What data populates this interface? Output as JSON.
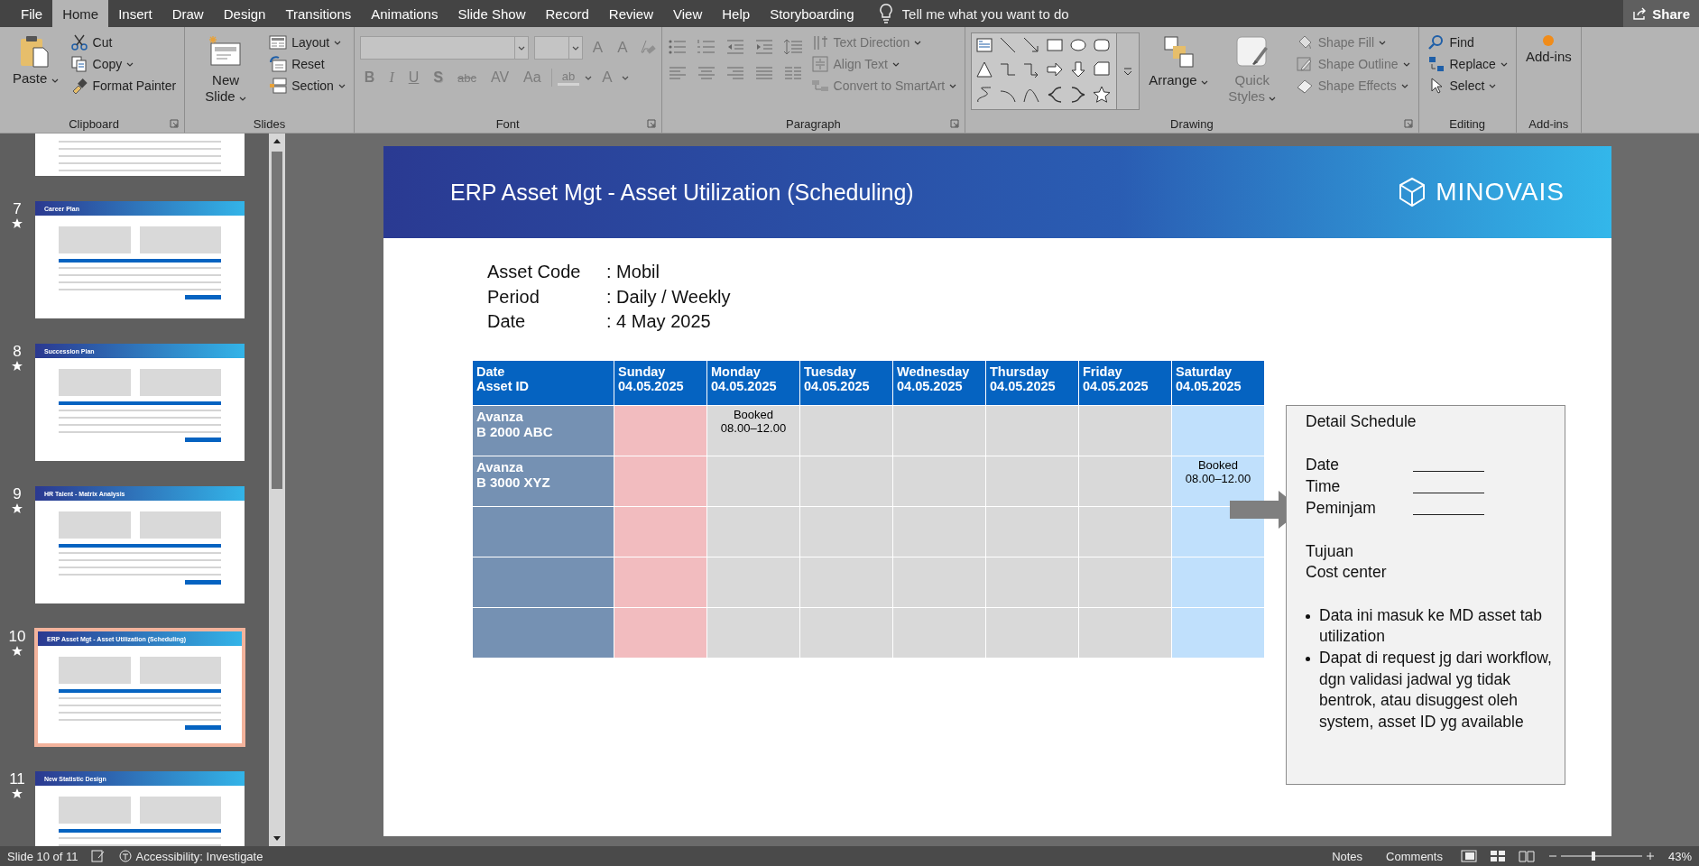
{
  "tabs": [
    {
      "label": "File",
      "selected": false
    },
    {
      "label": "Home",
      "selected": true
    },
    {
      "label": "Insert",
      "selected": false
    },
    {
      "label": "Draw",
      "selected": false
    },
    {
      "label": "Design",
      "selected": false
    },
    {
      "label": "Transitions",
      "selected": false
    },
    {
      "label": "Animations",
      "selected": false
    },
    {
      "label": "Slide Show",
      "selected": false
    },
    {
      "label": "Record",
      "selected": false
    },
    {
      "label": "Review",
      "selected": false
    },
    {
      "label": "View",
      "selected": false
    },
    {
      "label": "Help",
      "selected": false
    },
    {
      "label": "Storyboarding",
      "selected": false
    }
  ],
  "tell_me": {
    "placeholder": "Tell me what you want to do"
  },
  "share_button": "Share",
  "ribbon": {
    "groups": [
      {
        "label": "Clipboard",
        "launcher": true,
        "items": [
          {
            "kind": "large",
            "label": "Paste",
            "dropdown": true,
            "disabled": false
          },
          {
            "kind": "stack",
            "items": [
              {
                "label": "Cut",
                "dropdown": false,
                "disabled": false
              },
              {
                "label": "Copy",
                "dropdown": true,
                "disabled": false
              },
              {
                "label": "Format Painter",
                "dropdown": false,
                "disabled": false
              }
            ]
          }
        ]
      },
      {
        "label": "Slides",
        "launcher": false,
        "items": [
          {
            "kind": "large",
            "label": "New Slide",
            "dropdown": true,
            "disabled": false
          },
          {
            "kind": "stack",
            "items": [
              {
                "label": "Layout",
                "dropdown": true,
                "disabled": false
              },
              {
                "label": "Reset",
                "dropdown": false,
                "disabled": false
              },
              {
                "label": "Section",
                "dropdown": true,
                "disabled": false
              }
            ]
          }
        ]
      },
      {
        "label": "Font",
        "launcher": true,
        "items": [
          {
            "kind": "font",
            "disabled": true,
            "size_buttons": [
              "A",
              "A"
            ],
            "format_buttons": [
              "B",
              "I",
              "U",
              "S",
              "abc",
              "AV",
              "Aa"
            ],
            "highlight": "ab",
            "font_color": "A"
          }
        ]
      },
      {
        "label": "Paragraph",
        "launcher": true,
        "items": [
          {
            "kind": "paragraph",
            "disabled": true
          },
          {
            "kind": "stack",
            "items": [
              {
                "label": "Text Direction",
                "dropdown": true,
                "disabled": true
              },
              {
                "label": "Align Text",
                "dropdown": true,
                "disabled": true
              },
              {
                "label": "Convert to SmartArt",
                "dropdown": true,
                "disabled": true
              }
            ]
          }
        ]
      },
      {
        "label": "Drawing",
        "launcher": true,
        "items": [
          {
            "kind": "shapes"
          },
          {
            "kind": "large",
            "label": "Arrange",
            "dropdown": true,
            "disabled": false
          },
          {
            "kind": "large",
            "label": "Quick Styles",
            "dropdown": true,
            "disabled": true
          },
          {
            "kind": "stack",
            "items": [
              {
                "label": "Shape Fill",
                "dropdown": true,
                "disabled": true
              },
              {
                "label": "Shape Outline",
                "dropdown": true,
                "disabled": true
              },
              {
                "label": "Shape Effects",
                "dropdown": true,
                "disabled": true
              }
            ]
          }
        ]
      },
      {
        "label": "Editing",
        "launcher": false,
        "items": [
          {
            "kind": "stack",
            "items": [
              {
                "label": "Find",
                "dropdown": false,
                "disabled": false
              },
              {
                "label": "Replace",
                "dropdown": true,
                "disabled": false
              },
              {
                "label": "Select",
                "dropdown": true,
                "disabled": false
              }
            ]
          }
        ]
      },
      {
        "label": "Add-ins",
        "launcher": false,
        "items": [
          {
            "kind": "large",
            "label": "Add-ins",
            "dropdown": false,
            "disabled": false
          }
        ]
      }
    ]
  },
  "thumbnails": [
    {
      "kind": "partial",
      "selected": false
    },
    {
      "kind": "slide",
      "number": "7",
      "title": "Career Plan",
      "selected": false
    },
    {
      "kind": "slide",
      "number": "8",
      "title": "Succession Plan",
      "selected": false
    },
    {
      "kind": "slide",
      "number": "9",
      "title": "HR Talent - Matrix Analysis",
      "selected": false
    },
    {
      "kind": "slide",
      "number": "10",
      "title": "ERP Asset Mgt - Asset Utilization (Scheduling)",
      "selected": true
    },
    {
      "kind": "slide",
      "number": "11",
      "title": "New Statistic Design",
      "selected": false
    }
  ],
  "slide": {
    "title": "ERP Asset Mgt - Asset Utilization (Scheduling)",
    "logo": "MINOVAIS",
    "fields": [
      {
        "label": "Asset Code",
        "value": ": Mobil"
      },
      {
        "label": "Period",
        "value": ": Daily / Weekly"
      },
      {
        "label": "Date",
        "value": ": 4 May 2025"
      }
    ],
    "schedule": {
      "corner": [
        "Date",
        "Asset ID"
      ],
      "columns": [
        {
          "day": "Sunday",
          "date": "04.05.2025",
          "color": "#f2bcbf"
        },
        {
          "day": "Monday",
          "date": "04.05.2025",
          "color": "#d9d9d9"
        },
        {
          "day": "Tuesday",
          "date": "04.05.2025",
          "color": "#d9d9d9"
        },
        {
          "day": "Wednesday",
          "date": "04.05.2025",
          "color": "#d9d9d9"
        },
        {
          "day": "Thursday",
          "date": "04.05.2025",
          "color": "#d9d9d9"
        },
        {
          "day": "Friday",
          "date": "04.05.2025",
          "color": "#d9d9d9"
        },
        {
          "day": "Saturday",
          "date": "04.05.2025",
          "color": "#c0e0fc"
        }
      ],
      "rows": [
        {
          "kind": "asset",
          "asset": [
            "Avanza",
            "B 2000 ABC"
          ],
          "cells": [
            null,
            [
              "Booked",
              "08.00–12.00"
            ],
            null,
            null,
            null,
            null,
            null
          ]
        },
        {
          "kind": "asset",
          "asset": [
            "Avanza",
            "B 3000 XYZ"
          ],
          "cells": [
            null,
            null,
            null,
            null,
            null,
            null,
            [
              "Booked",
              "08.00–12.00"
            ]
          ]
        },
        {
          "kind": "blank"
        },
        {
          "kind": "blank"
        },
        {
          "kind": "blank"
        }
      ]
    },
    "detail": {
      "title": "Detail Schedule",
      "fields": [
        "Date",
        "Time",
        "Peminjam"
      ],
      "extra": [
        "Tujuan",
        "Cost center"
      ],
      "notes": [
        "Data ini masuk ke MD asset tab utilization",
        "Dapat di request jg dari workflow, dgn validasi jadwal yg tidak bentrok, atau disuggest oleh system, asset ID yg available"
      ]
    }
  },
  "status_bar": {
    "slide_counter": "Slide 10 of 11",
    "accessibility": "Accessibility: Investigate",
    "notes": "Notes",
    "comments": "Comments",
    "zoom": "43%",
    "zoom_slider": {
      "level": 0.4
    }
  }
}
